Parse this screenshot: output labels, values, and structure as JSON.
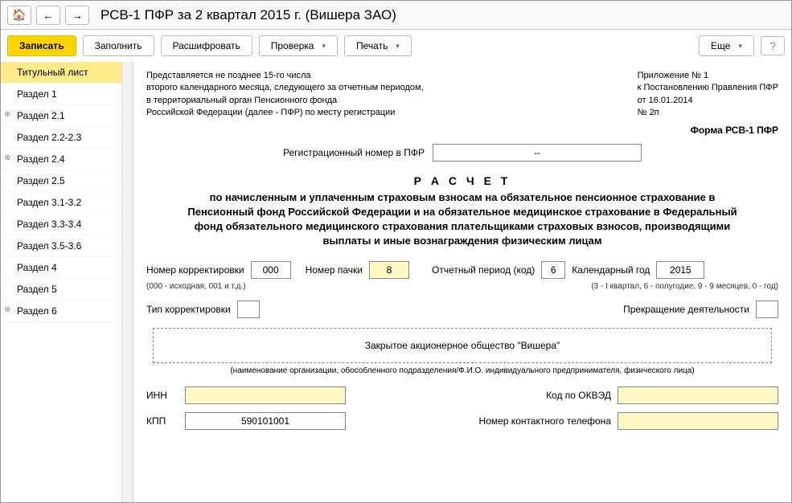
{
  "title": "РСВ-1 ПФР за 2 квартал 2015 г. (Вишера ЗАО)",
  "toolbar": {
    "save": "Записать",
    "fill": "Заполнить",
    "decode": "Расшифровать",
    "check": "Проверка",
    "print": "Печать",
    "more": "Еще"
  },
  "sidebar": {
    "items": [
      {
        "label": "Титульный лист",
        "active": true,
        "exp": false
      },
      {
        "label": "Раздел 1",
        "active": false,
        "exp": false
      },
      {
        "label": "Раздел 2.1",
        "active": false,
        "exp": true
      },
      {
        "label": "Раздел 2.2-2.3",
        "active": false,
        "exp": false
      },
      {
        "label": "Раздел 2.4",
        "active": false,
        "exp": true
      },
      {
        "label": "Раздел 2.5",
        "active": false,
        "exp": false
      },
      {
        "label": "Раздел 3.1-3.2",
        "active": false,
        "exp": false
      },
      {
        "label": "Раздел 3.3-3.4",
        "active": false,
        "exp": false
      },
      {
        "label": "Раздел 3.5-3.6",
        "active": false,
        "exp": false
      },
      {
        "label": "Раздел 4",
        "active": false,
        "exp": false
      },
      {
        "label": "Раздел 5",
        "active": false,
        "exp": false
      },
      {
        "label": "Раздел 6",
        "active": false,
        "exp": true
      }
    ]
  },
  "intro": {
    "line1": "Представляется не позднее 15-го числа",
    "line2": "второго календарного месяца, следующего за отчетным периодом,",
    "line3": "в территориальный орган Пенсионного фонда",
    "line4": "Российской Федерации (далее - ПФР) по месту регистрации"
  },
  "appendix": {
    "line1": "Приложение № 1",
    "line2": "к Постановлению Правления ПФР",
    "line3": "от 16.01.2014",
    "line4": "№ 2п"
  },
  "form_name": "Форма РСВ-1 ПФР",
  "reg": {
    "label": "Регистрационный номер в ПФР",
    "value": "--"
  },
  "calc": {
    "heading": "Р А С Ч Е Т",
    "body": "по начисленным и уплаченным страховым взносам на обязательное пенсионное страхование в Пенсионный фонд Российской Федерации и на обязательное медицинское страхование в Федеральный фонд обязательного медицинского страхования плательщиками страховых взносов, производящими выплаты и иные вознаграждения физическим лицам"
  },
  "params": {
    "corr_label": "Номер корректировки",
    "corr_value": "000",
    "corr_hint": "(000 - исходная, 001 и т.д.)",
    "pack_label": "Номер пачки",
    "pack_value": "8",
    "period_label": "Отчетный период (код)",
    "period_value": "6",
    "year_label": "Календарный год",
    "year_value": "2015",
    "period_hint": "(3 - I квартал, 6 - полугодие, 9 - 9 месяцев, 0 - год)"
  },
  "type_corr": {
    "label": "Тип корректировки",
    "value": "",
    "cease_label": "Прекращение деятельности"
  },
  "org": {
    "name": "Закрытое акционерное общество \"Вишера\"",
    "hint": "(наименование организации, обособленного подразделения/Ф.И.О. индивидуального предпринимателя, физического лица)"
  },
  "fields": {
    "inn_label": "ИНН",
    "inn_value": "",
    "okved_label": "Код по ОКВЭД",
    "okved_value": "",
    "kpp_label": "КПП",
    "kpp_value": "590101001",
    "phone_label": "Номер контактного телефона",
    "phone_value": ""
  }
}
